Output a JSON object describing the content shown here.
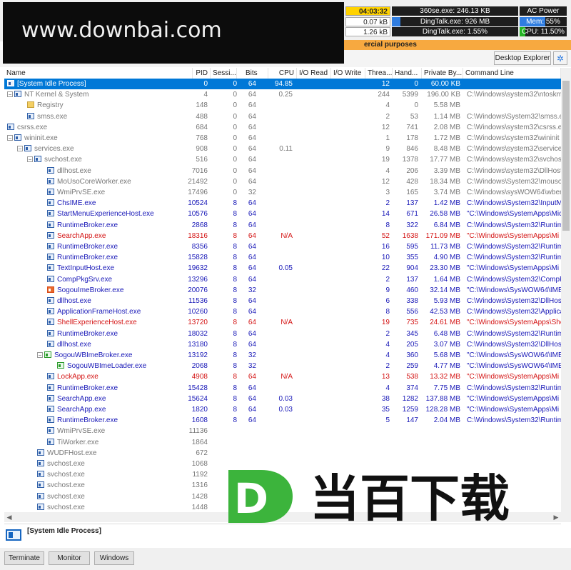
{
  "status": {
    "time": "04:03:32",
    "top_process": "360se.exe: 246.13 KB",
    "power": "AC Power",
    "io_a": "0.07 kB",
    "io_b": "1.26 kB",
    "top_mem": "DingTalk.exe: 926 MB",
    "top_cpu": "DingTalk.exe: 1.55%",
    "mem": "Mem: 55%",
    "mem_pct": 55,
    "cpu": "CPU: 11.50%",
    "cpu_pct": 11.5,
    "top_mem_pct": 7
  },
  "watermark": "www.downbai.com",
  "banner": "ercial purposes",
  "toolbar": {
    "desktop_explorer": "Desktop Explorer"
  },
  "columns": [
    "Name",
    "PID",
    "Sessi...",
    "Bits",
    "CPU",
    "I/O Read",
    "I/O Write",
    "Threa...",
    "Hand...",
    "Private By...",
    "Command Line"
  ],
  "processes": [
    {
      "indent": 0,
      "toggle": "",
      "icon": "window",
      "name": "[System Idle Process]",
      "pid": "0",
      "sess": "0",
      "bits": "64",
      "cpu": "94.85",
      "thr": "12",
      "hnd": "0",
      "prv": "60.00 KB",
      "cmd": "",
      "style": "sel"
    },
    {
      "indent": 0,
      "toggle": "−",
      "icon": "window",
      "name": "NT Kernel & System",
      "pid": "4",
      "sess": "0",
      "bits": "64",
      "cpu": "0.25",
      "thr": "244",
      "hnd": "5399",
      "prv": "196.00 KB",
      "cmd": "C:\\Windows\\system32\\ntoskrnl",
      "style": "gray"
    },
    {
      "indent": 2,
      "toggle": "",
      "icon": "folder",
      "name": "Registry",
      "pid": "148",
      "sess": "0",
      "bits": "64",
      "cpu": "",
      "thr": "4",
      "hnd": "0",
      "prv": "5.58 MB",
      "cmd": "",
      "style": "gray"
    },
    {
      "indent": 2,
      "toggle": "",
      "icon": "window",
      "name": "smss.exe",
      "pid": "488",
      "sess": "0",
      "bits": "64",
      "cpu": "",
      "thr": "2",
      "hnd": "53",
      "prv": "1.14 MB",
      "cmd": "C:\\Windows\\System32\\smss.exe",
      "style": "gray"
    },
    {
      "indent": 0,
      "toggle": "",
      "icon": "window",
      "name": "csrss.exe",
      "pid": "684",
      "sess": "0",
      "bits": "64",
      "cpu": "",
      "thr": "12",
      "hnd": "741",
      "prv": "2.08 MB",
      "cmd": "C:\\Windows\\system32\\csrss.exe",
      "style": "gray"
    },
    {
      "indent": 0,
      "toggle": "−",
      "icon": "window",
      "name": "wininit.exe",
      "pid": "768",
      "sess": "0",
      "bits": "64",
      "cpu": "",
      "thr": "1",
      "hnd": "178",
      "prv": "1.72 MB",
      "cmd": "C:\\Windows\\system32\\wininit",
      "style": "gray"
    },
    {
      "indent": 1,
      "toggle": "−",
      "icon": "window",
      "name": "services.exe",
      "pid": "908",
      "sess": "0",
      "bits": "64",
      "cpu": "0.11",
      "thr": "9",
      "hnd": "846",
      "prv": "8.48 MB",
      "cmd": "C:\\Windows\\system32\\services",
      "style": "gray"
    },
    {
      "indent": 2,
      "toggle": "−",
      "icon": "window",
      "name": "svchost.exe",
      "pid": "516",
      "sess": "0",
      "bits": "64",
      "cpu": "",
      "thr": "19",
      "hnd": "1378",
      "prv": "17.77 MB",
      "cmd": "C:\\Windows\\system32\\svchost",
      "style": "gray"
    },
    {
      "indent": 4,
      "toggle": "",
      "icon": "window",
      "name": "dllhost.exe",
      "pid": "7016",
      "sess": "0",
      "bits": "64",
      "cpu": "",
      "thr": "4",
      "hnd": "206",
      "prv": "3.39 MB",
      "cmd": "C:\\Windows\\system32\\DllHost",
      "style": "gray"
    },
    {
      "indent": 4,
      "toggle": "",
      "icon": "window",
      "name": "MoUsoCoreWorker.exe",
      "pid": "21492",
      "sess": "0",
      "bits": "64",
      "cpu": "",
      "thr": "12",
      "hnd": "428",
      "prv": "18.34 MB",
      "cmd": "C:\\Windows\\System32\\mousoc",
      "style": "gray"
    },
    {
      "indent": 4,
      "toggle": "",
      "icon": "window",
      "name": "WmiPrvSE.exe",
      "pid": "17496",
      "sess": "0",
      "bits": "32",
      "cpu": "",
      "thr": "3",
      "hnd": "165",
      "prv": "3.74 MB",
      "cmd": "C:\\Windows\\sysWOW64\\wbem",
      "style": "gray"
    },
    {
      "indent": 4,
      "toggle": "",
      "icon": "window",
      "name": "ChsIME.exe",
      "pid": "10524",
      "sess": "8",
      "bits": "64",
      "cpu": "",
      "thr": "2",
      "hnd": "137",
      "prv": "1.42 MB",
      "cmd": "C:\\Windows\\System32\\InputM",
      "style": "blue"
    },
    {
      "indent": 4,
      "toggle": "",
      "icon": "window",
      "name": "StartMenuExperienceHost.exe",
      "pid": "10576",
      "sess": "8",
      "bits": "64",
      "cpu": "",
      "thr": "14",
      "hnd": "671",
      "prv": "26.58 MB",
      "cmd": "\"C:\\Windows\\SystemApps\\Micr",
      "style": "blue"
    },
    {
      "indent": 4,
      "toggle": "",
      "icon": "window",
      "name": "RuntimeBroker.exe",
      "pid": "2868",
      "sess": "8",
      "bits": "64",
      "cpu": "",
      "thr": "8",
      "hnd": "322",
      "prv": "6.84 MB",
      "cmd": "C:\\Windows\\System32\\Runtim",
      "style": "blue"
    },
    {
      "indent": 4,
      "toggle": "",
      "icon": "window",
      "name": "SearchApp.exe",
      "pid": "18316",
      "sess": "8",
      "bits": "64",
      "cpu": "N/A",
      "thr": "52",
      "hnd": "1638",
      "prv": "171.09 MB",
      "cmd": "\"C:\\Windows\\SystemApps\\Mi",
      "style": "red"
    },
    {
      "indent": 4,
      "toggle": "",
      "icon": "window",
      "name": "RuntimeBroker.exe",
      "pid": "8356",
      "sess": "8",
      "bits": "64",
      "cpu": "",
      "thr": "16",
      "hnd": "595",
      "prv": "11.73 MB",
      "cmd": "C:\\Windows\\System32\\Runtim",
      "style": "blue"
    },
    {
      "indent": 4,
      "toggle": "",
      "icon": "window",
      "name": "RuntimeBroker.exe",
      "pid": "15828",
      "sess": "8",
      "bits": "64",
      "cpu": "",
      "thr": "10",
      "hnd": "355",
      "prv": "4.90 MB",
      "cmd": "C:\\Windows\\System32\\Runtim",
      "style": "blue"
    },
    {
      "indent": 4,
      "toggle": "",
      "icon": "window",
      "name": "TextInputHost.exe",
      "pid": "19632",
      "sess": "8",
      "bits": "64",
      "cpu": "0.05",
      "thr": "22",
      "hnd": "904",
      "prv": "23.30 MB",
      "cmd": "\"C:\\Windows\\SystemApps\\Mi",
      "style": "blue"
    },
    {
      "indent": 4,
      "toggle": "",
      "icon": "window",
      "name": "CompPkgSrv.exe",
      "pid": "13296",
      "sess": "8",
      "bits": "64",
      "cpu": "",
      "thr": "2",
      "hnd": "137",
      "prv": "1.64 MB",
      "cmd": "C:\\Windows\\System32\\CompP",
      "style": "blue"
    },
    {
      "indent": 4,
      "toggle": "",
      "icon": "sg",
      "name": "SogouImeBroker.exe",
      "pid": "20076",
      "sess": "8",
      "bits": "32",
      "cpu": "",
      "thr": "9",
      "hnd": "460",
      "prv": "32.14 MB",
      "cmd": "\"C:\\Windows\\SysWOW64\\IME",
      "style": "blue"
    },
    {
      "indent": 4,
      "toggle": "",
      "icon": "window",
      "name": "dllhost.exe",
      "pid": "11536",
      "sess": "8",
      "bits": "64",
      "cpu": "",
      "thr": "6",
      "hnd": "338",
      "prv": "5.93 MB",
      "cmd": "C:\\Windows\\System32\\DllHost",
      "style": "blue"
    },
    {
      "indent": 4,
      "toggle": "",
      "icon": "window",
      "name": "ApplicationFrameHost.exe",
      "pid": "10260",
      "sess": "8",
      "bits": "64",
      "cpu": "",
      "thr": "8",
      "hnd": "556",
      "prv": "42.53 MB",
      "cmd": "C:\\Windows\\System32\\Applica",
      "style": "blue"
    },
    {
      "indent": 4,
      "toggle": "",
      "icon": "window",
      "name": "ShellExperienceHost.exe",
      "pid": "13720",
      "sess": "8",
      "bits": "64",
      "cpu": "N/A",
      "thr": "19",
      "hnd": "735",
      "prv": "24.61 MB",
      "cmd": "\"C:\\Windows\\SystemApps\\She",
      "style": "red"
    },
    {
      "indent": 4,
      "toggle": "",
      "icon": "window",
      "name": "RuntimeBroker.exe",
      "pid": "18032",
      "sess": "8",
      "bits": "64",
      "cpu": "",
      "thr": "2",
      "hnd": "345",
      "prv": "6.48 MB",
      "cmd": "C:\\Windows\\System32\\Runtim",
      "style": "blue"
    },
    {
      "indent": 4,
      "toggle": "",
      "icon": "window",
      "name": "dllhost.exe",
      "pid": "13180",
      "sess": "8",
      "bits": "64",
      "cpu": "",
      "thr": "4",
      "hnd": "205",
      "prv": "3.07 MB",
      "cmd": "C:\\Windows\\System32\\DllHost",
      "style": "blue"
    },
    {
      "indent": 3,
      "toggle": "−",
      "icon": "sgw",
      "name": "SogouWBImeBroker.exe",
      "pid": "13192",
      "sess": "8",
      "bits": "32",
      "cpu": "",
      "thr": "4",
      "hnd": "360",
      "prv": "5.68 MB",
      "cmd": "\"C:\\Windows\\SysWOW64\\IME",
      "style": "blue"
    },
    {
      "indent": 5,
      "toggle": "",
      "icon": "sgw",
      "name": "SogouWBImeLoader.exe",
      "pid": "2068",
      "sess": "8",
      "bits": "32",
      "cpu": "",
      "thr": "2",
      "hnd": "259",
      "prv": "4.77 MB",
      "cmd": "\"C:\\Windows\\SysWOW64\\IME",
      "style": "blue"
    },
    {
      "indent": 4,
      "toggle": "",
      "icon": "window",
      "name": "LockApp.exe",
      "pid": "4908",
      "sess": "8",
      "bits": "64",
      "cpu": "N/A",
      "thr": "13",
      "hnd": "538",
      "prv": "13.32 MB",
      "cmd": "\"C:\\Windows\\SystemApps\\Mi",
      "style": "red"
    },
    {
      "indent": 4,
      "toggle": "",
      "icon": "window",
      "name": "RuntimeBroker.exe",
      "pid": "15428",
      "sess": "8",
      "bits": "64",
      "cpu": "",
      "thr": "4",
      "hnd": "374",
      "prv": "7.75 MB",
      "cmd": "C:\\Windows\\System32\\Runtim",
      "style": "blue"
    },
    {
      "indent": 4,
      "toggle": "",
      "icon": "window",
      "name": "SearchApp.exe",
      "pid": "15624",
      "sess": "8",
      "bits": "64",
      "cpu": "0.03",
      "thr": "38",
      "hnd": "1282",
      "prv": "137.88 MB",
      "cmd": "\"C:\\Windows\\SystemApps\\Mi",
      "style": "blue"
    },
    {
      "indent": 4,
      "toggle": "",
      "icon": "window",
      "name": "SearchApp.exe",
      "pid": "1820",
      "sess": "8",
      "bits": "64",
      "cpu": "0.03",
      "thr": "35",
      "hnd": "1259",
      "prv": "128.28 MB",
      "cmd": "\"C:\\Windows\\SystemApps\\Mi",
      "style": "blue"
    },
    {
      "indent": 4,
      "toggle": "",
      "icon": "window",
      "name": "RuntimeBroker.exe",
      "pid": "1608",
      "sess": "8",
      "bits": "64",
      "cpu": "",
      "thr": "5",
      "hnd": "147",
      "prv": "2.04 MB",
      "cmd": "C:\\Windows\\System32\\Runtim",
      "style": "blue"
    },
    {
      "indent": 4,
      "toggle": "",
      "icon": "window",
      "name": "WmiPrvSE.exe",
      "pid": "11136",
      "sess": "",
      "bits": "",
      "cpu": "",
      "thr": "",
      "hnd": "",
      "prv": "",
      "cmd": "",
      "style": "gray"
    },
    {
      "indent": 4,
      "toggle": "",
      "icon": "window",
      "name": "TiWorker.exe",
      "pid": "1864",
      "sess": "",
      "bits": "",
      "cpu": "",
      "thr": "",
      "hnd": "",
      "prv": "",
      "cmd": "",
      "style": "gray"
    },
    {
      "indent": 3,
      "toggle": "",
      "icon": "window",
      "name": "WUDFHost.exe",
      "pid": "672",
      "sess": "",
      "bits": "",
      "cpu": "",
      "thr": "",
      "hnd": "",
      "prv": "",
      "cmd": "",
      "style": "gray"
    },
    {
      "indent": 3,
      "toggle": "",
      "icon": "window",
      "name": "svchost.exe",
      "pid": "1068",
      "sess": "",
      "bits": "",
      "cpu": "",
      "thr": "",
      "hnd": "",
      "prv": "",
      "cmd": "",
      "style": "gray"
    },
    {
      "indent": 3,
      "toggle": "",
      "icon": "window",
      "name": "svchost.exe",
      "pid": "1192",
      "sess": "",
      "bits": "",
      "cpu": "",
      "thr": "",
      "hnd": "",
      "prv": "",
      "cmd": "",
      "style": "gray"
    },
    {
      "indent": 3,
      "toggle": "",
      "icon": "window",
      "name": "svchost.exe",
      "pid": "1316",
      "sess": "",
      "bits": "",
      "cpu": "",
      "thr": "",
      "hnd": "",
      "prv": "",
      "cmd": "",
      "style": "gray"
    },
    {
      "indent": 3,
      "toggle": "",
      "icon": "window",
      "name": "svchost.exe",
      "pid": "1428",
      "sess": "",
      "bits": "",
      "cpu": "",
      "thr": "",
      "hnd": "",
      "prv": "",
      "cmd": "",
      "style": "gray"
    },
    {
      "indent": 3,
      "toggle": "",
      "icon": "window",
      "name": "svchost.exe",
      "pid": "1448",
      "sess": "",
      "bits": "",
      "cpu": "",
      "thr": "",
      "hnd": "",
      "prv": "",
      "cmd": "",
      "style": "gray"
    }
  ],
  "selected": {
    "name": "[System Idle Process]"
  },
  "logo": {
    "letter": "D",
    "text": "当百下载",
    "green": "#3cb43c",
    "dark": "#111111"
  },
  "buttons": {
    "terminate": "Terminate",
    "monitor": "Monitor",
    "windows": "Windows"
  },
  "colors": {
    "selection": "#0078d7",
    "blue_text": "#1a1ab8",
    "red_text": "#d41414",
    "gray_text": "#777777"
  }
}
